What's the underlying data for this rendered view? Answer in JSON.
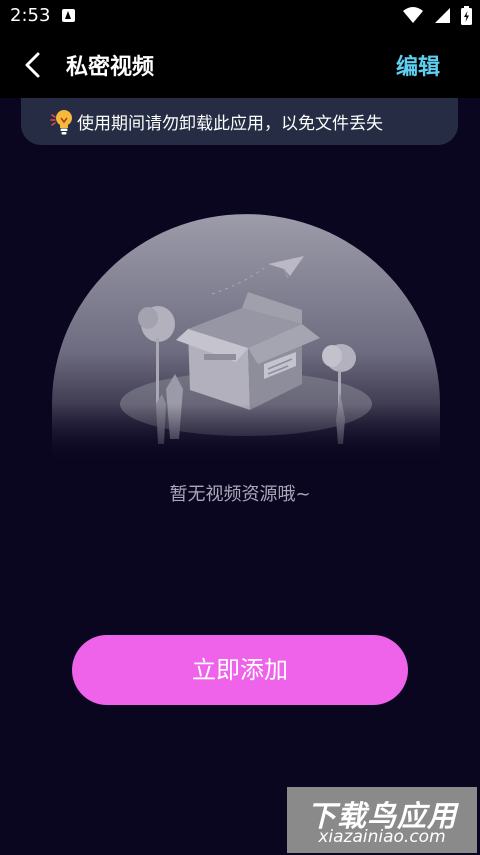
{
  "status_bar": {
    "time": "2:53"
  },
  "header": {
    "title": "私密视频",
    "edit_label": "编辑"
  },
  "notice": {
    "text": "使用期间请勿卸载此应用，以免文件丢失"
  },
  "empty_state": {
    "text": "暂无视频资源哦~"
  },
  "add_button": {
    "label": "立即添加"
  },
  "watermark": {
    "title": "下载鸟应用",
    "url": "xiazainiao.com"
  },
  "colors": {
    "background": "#0b0620",
    "accent_edit": "#5fd0f0",
    "button": "#ef62ea",
    "notice_bg": "#252c44"
  }
}
